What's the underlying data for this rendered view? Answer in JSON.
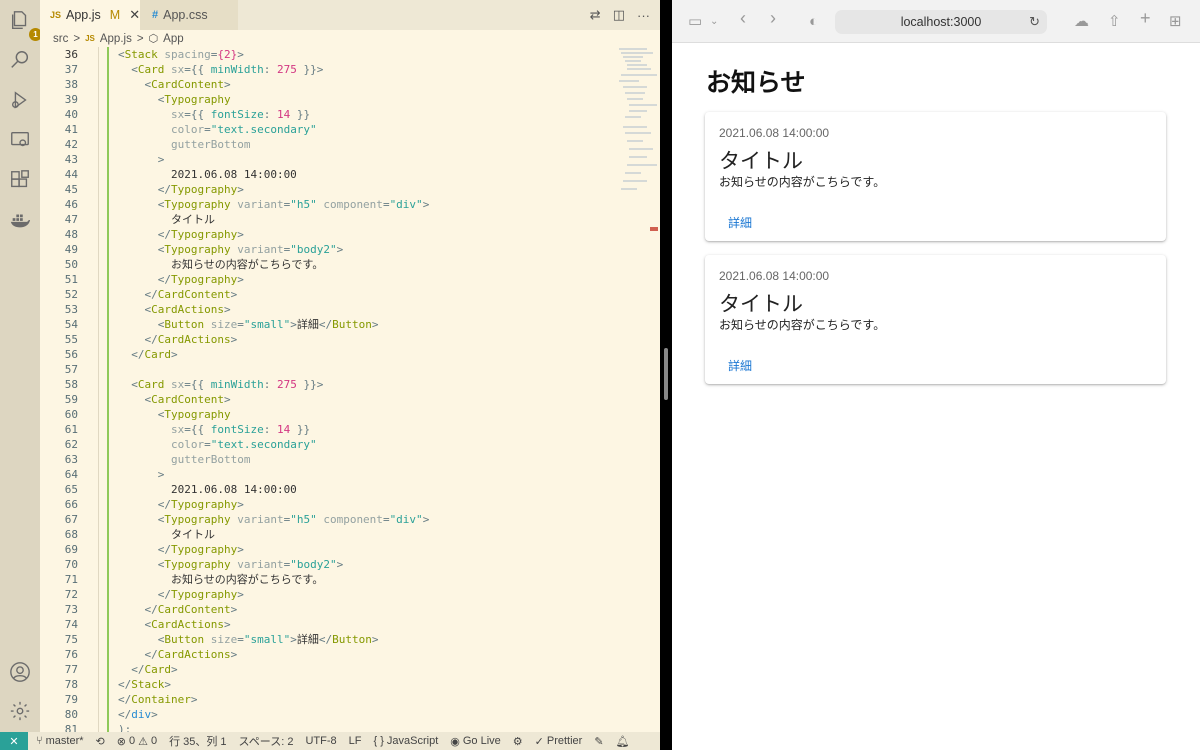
{
  "vscode": {
    "tabs": [
      {
        "type": "JS",
        "name": "App.js",
        "status": "M"
      },
      {
        "type": "#",
        "name": "App.css"
      }
    ],
    "breadcrumb": [
      "src",
      ">",
      "JS",
      "App.js",
      ">",
      "App"
    ],
    "explorer_badge": "1",
    "line_numbers": [
      "36",
      "37",
      "38",
      "39",
      "40",
      "41",
      "42",
      "43",
      "44",
      "45",
      "46",
      "47",
      "48",
      "49",
      "50",
      "51",
      "52",
      "53",
      "54",
      "55",
      "56",
      "57",
      "58",
      "59",
      "60",
      "61",
      "62",
      "63",
      "64",
      "65",
      "66",
      "67",
      "68",
      "69",
      "70",
      "71",
      "72",
      "73",
      "74",
      "75",
      "76",
      "77",
      "78",
      "79",
      "80",
      "81"
    ],
    "code_lines": [
      [
        [
          "pun",
          "<"
        ],
        [
          "comp",
          "Stack"
        ],
        [
          "attr",
          " spacing"
        ],
        [
          "pun",
          "="
        ],
        [
          "num",
          "{2}"
        ],
        [
          "pun",
          ">"
        ]
      ],
      [
        [
          "pun",
          "  <"
        ],
        [
          "comp",
          "Card"
        ],
        [
          "attr",
          " sx"
        ],
        [
          "pun",
          "={{ "
        ],
        [
          "str",
          "minWidth"
        ],
        [
          "pun",
          ": "
        ],
        [
          "num",
          "275"
        ],
        [
          "pun",
          " }}>"
        ]
      ],
      [
        [
          "pun",
          "    <"
        ],
        [
          "comp",
          "CardContent"
        ],
        [
          "pun",
          ">"
        ]
      ],
      [
        [
          "pun",
          "      <"
        ],
        [
          "comp",
          "Typography"
        ]
      ],
      [
        [
          "attr",
          "        sx"
        ],
        [
          "pun",
          "={{ "
        ],
        [
          "str",
          "fontSize"
        ],
        [
          "pun",
          ": "
        ],
        [
          "num",
          "14"
        ],
        [
          "pun",
          " }}"
        ]
      ],
      [
        [
          "attr",
          "        color"
        ],
        [
          "pun",
          "="
        ],
        [
          "str",
          "\"text.secondary\""
        ]
      ],
      [
        [
          "attr",
          "        gutterBottom"
        ]
      ],
      [
        [
          "pun",
          "      >"
        ]
      ],
      [
        [
          "txt",
          "        2021.06.08 14:00:00"
        ]
      ],
      [
        [
          "pun",
          "      </"
        ],
        [
          "comp",
          "Typography"
        ],
        [
          "pun",
          ">"
        ]
      ],
      [
        [
          "pun",
          "      <"
        ],
        [
          "comp",
          "Typography"
        ],
        [
          "attr",
          " variant"
        ],
        [
          "pun",
          "="
        ],
        [
          "str",
          "\"h5\""
        ],
        [
          "attr",
          " component"
        ],
        [
          "pun",
          "="
        ],
        [
          "str",
          "\"div\""
        ],
        [
          "pun",
          ">"
        ]
      ],
      [
        [
          "txt",
          "        タイトル"
        ]
      ],
      [
        [
          "pun",
          "      </"
        ],
        [
          "comp",
          "Typography"
        ],
        [
          "pun",
          ">"
        ]
      ],
      [
        [
          "pun",
          "      <"
        ],
        [
          "comp",
          "Typography"
        ],
        [
          "attr",
          " variant"
        ],
        [
          "pun",
          "="
        ],
        [
          "str",
          "\"body2\""
        ],
        [
          "pun",
          ">"
        ]
      ],
      [
        [
          "txt",
          "        お知らせの内容がこちらです。"
        ]
      ],
      [
        [
          "pun",
          "      </"
        ],
        [
          "comp",
          "Typography"
        ],
        [
          "pun",
          ">"
        ]
      ],
      [
        [
          "pun",
          "    </"
        ],
        [
          "comp",
          "CardContent"
        ],
        [
          "pun",
          ">"
        ]
      ],
      [
        [
          "pun",
          "    <"
        ],
        [
          "comp",
          "CardActions"
        ],
        [
          "pun",
          ">"
        ]
      ],
      [
        [
          "pun",
          "      <"
        ],
        [
          "comp",
          "Button"
        ],
        [
          "attr",
          " size"
        ],
        [
          "pun",
          "="
        ],
        [
          "str",
          "\"small\""
        ],
        [
          "pun",
          ">"
        ],
        [
          "txt",
          "詳細"
        ],
        [
          "pun",
          "</"
        ],
        [
          "comp",
          "Button"
        ],
        [
          "pun",
          ">"
        ]
      ],
      [
        [
          "pun",
          "    </"
        ],
        [
          "comp",
          "CardActions"
        ],
        [
          "pun",
          ">"
        ]
      ],
      [
        [
          "pun",
          "  </"
        ],
        [
          "comp",
          "Card"
        ],
        [
          "pun",
          ">"
        ]
      ],
      [
        [
          "txt",
          ""
        ]
      ],
      [
        [
          "pun",
          "  <"
        ],
        [
          "comp",
          "Card"
        ],
        [
          "attr",
          " sx"
        ],
        [
          "pun",
          "={{ "
        ],
        [
          "str",
          "minWidth"
        ],
        [
          "pun",
          ": "
        ],
        [
          "num",
          "275"
        ],
        [
          "pun",
          " }}>"
        ]
      ],
      [
        [
          "pun",
          "    <"
        ],
        [
          "comp",
          "CardContent"
        ],
        [
          "pun",
          ">"
        ]
      ],
      [
        [
          "pun",
          "      <"
        ],
        [
          "comp",
          "Typography"
        ]
      ],
      [
        [
          "attr",
          "        sx"
        ],
        [
          "pun",
          "={{ "
        ],
        [
          "str",
          "fontSize"
        ],
        [
          "pun",
          ": "
        ],
        [
          "num",
          "14"
        ],
        [
          "pun",
          " }}"
        ]
      ],
      [
        [
          "attr",
          "        color"
        ],
        [
          "pun",
          "="
        ],
        [
          "str",
          "\"text.secondary\""
        ]
      ],
      [
        [
          "attr",
          "        gutterBottom"
        ]
      ],
      [
        [
          "pun",
          "      >"
        ]
      ],
      [
        [
          "txt",
          "        2021.06.08 14:00:00"
        ]
      ],
      [
        [
          "pun",
          "      </"
        ],
        [
          "comp",
          "Typography"
        ],
        [
          "pun",
          ">"
        ]
      ],
      [
        [
          "pun",
          "      <"
        ],
        [
          "comp",
          "Typography"
        ],
        [
          "attr",
          " variant"
        ],
        [
          "pun",
          "="
        ],
        [
          "str",
          "\"h5\""
        ],
        [
          "attr",
          " component"
        ],
        [
          "pun",
          "="
        ],
        [
          "str",
          "\"div\""
        ],
        [
          "pun",
          ">"
        ]
      ],
      [
        [
          "txt",
          "        タイトル"
        ]
      ],
      [
        [
          "pun",
          "      </"
        ],
        [
          "comp",
          "Typography"
        ],
        [
          "pun",
          ">"
        ]
      ],
      [
        [
          "pun",
          "      <"
        ],
        [
          "comp",
          "Typography"
        ],
        [
          "attr",
          " variant"
        ],
        [
          "pun",
          "="
        ],
        [
          "str",
          "\"body2\""
        ],
        [
          "pun",
          ">"
        ]
      ],
      [
        [
          "txt",
          "        お知らせの内容がこちらです。"
        ]
      ],
      [
        [
          "pun",
          "      </"
        ],
        [
          "comp",
          "Typography"
        ],
        [
          "pun",
          ">"
        ]
      ],
      [
        [
          "pun",
          "    </"
        ],
        [
          "comp",
          "CardContent"
        ],
        [
          "pun",
          ">"
        ]
      ],
      [
        [
          "pun",
          "    <"
        ],
        [
          "comp",
          "CardActions"
        ],
        [
          "pun",
          ">"
        ]
      ],
      [
        [
          "pun",
          "      <"
        ],
        [
          "comp",
          "Button"
        ],
        [
          "attr",
          " size"
        ],
        [
          "pun",
          "="
        ],
        [
          "str",
          "\"small\""
        ],
        [
          "pun",
          ">"
        ],
        [
          "txt",
          "詳細"
        ],
        [
          "pun",
          "</"
        ],
        [
          "comp",
          "Button"
        ],
        [
          "pun",
          ">"
        ]
      ],
      [
        [
          "pun",
          "    </"
        ],
        [
          "comp",
          "CardActions"
        ],
        [
          "pun",
          ">"
        ]
      ],
      [
        [
          "pun",
          "  </"
        ],
        [
          "comp",
          "Card"
        ],
        [
          "pun",
          ">"
        ]
      ],
      [
        [
          "pun",
          "</"
        ],
        [
          "comp",
          "Stack"
        ],
        [
          "pun",
          ">"
        ]
      ],
      [
        [
          "pun",
          "</"
        ],
        [
          "comp",
          "Container"
        ],
        [
          "pun",
          ">"
        ]
      ],
      [
        [
          "pun",
          "</"
        ],
        [
          "tag",
          "div"
        ],
        [
          "pun",
          ">"
        ]
      ],
      [
        [
          "pun",
          ");"
        ]
      ]
    ],
    "status": {
      "branch": "master*",
      "errors": "0",
      "warnings": "0",
      "position": "行 35、列 1",
      "spaces": "スペース: 2",
      "encoding": "UTF-8",
      "eol": "LF",
      "language": "JavaScript",
      "golive": "Go Live",
      "prettier": "Prettier"
    }
  },
  "browser": {
    "url": "localhost:3000",
    "page_title": "お知らせ",
    "cards": [
      {
        "date": "2021.06.08 14:00:00",
        "title": "タイトル",
        "body": "お知らせの内容がこちらです。",
        "button": "詳細"
      },
      {
        "date": "2021.06.08 14:00:00",
        "title": "タイトル",
        "body": "お知らせの内容がこちらです。",
        "button": "詳細"
      }
    ]
  },
  "colors": {
    "editor_bg": "#fdf6e3",
    "activity_bg": "#ddd6c1",
    "component": "#859900",
    "string": "#2aa198",
    "number": "#d33682",
    "link_blue": "#1976d2"
  }
}
